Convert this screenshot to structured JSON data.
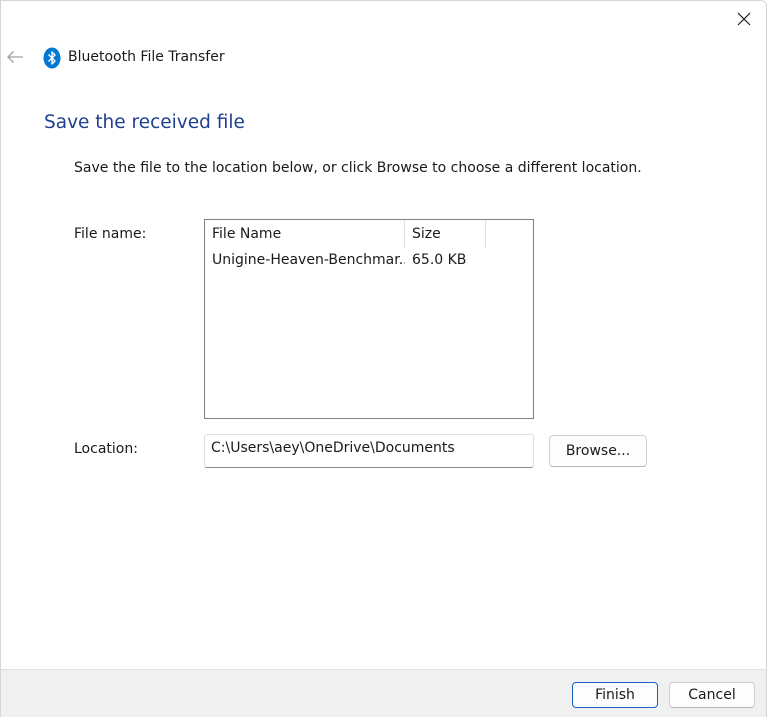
{
  "window": {
    "title": "Bluetooth File Transfer",
    "close_icon": "close-icon",
    "back_icon": "arrow-left-icon",
    "app_icon": "bluetooth-icon",
    "accent_color": "#0078d4"
  },
  "page": {
    "title": "Save the received file",
    "instructions": "Save the file to the location below, or click Browse to choose a different location."
  },
  "file_section": {
    "label": "File name:",
    "columns": [
      "File Name",
      "Size"
    ],
    "rows": [
      {
        "name": "Unigine-Heaven-Benchmar...",
        "size": "65.0 KB"
      }
    ]
  },
  "location_section": {
    "label": "Location:",
    "value": "C:\\Users\\aey\\OneDrive\\Documents",
    "browse_label": "Browse..."
  },
  "footer": {
    "finish_label": "Finish",
    "cancel_label": "Cancel"
  }
}
